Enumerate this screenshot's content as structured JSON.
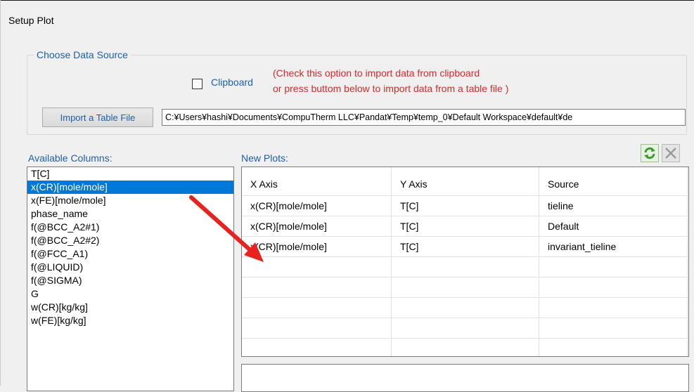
{
  "window": {
    "title": "Setup Plot"
  },
  "data_source": {
    "group_label": "Choose Data Source",
    "clipboard_label": "Clipboard",
    "clipboard_checked": false,
    "note_line1": "(Check this option to import data from clipboard",
    "note_line2": "or press buttom below to import data from a table file )",
    "import_button_label": "Import a Table File",
    "file_path": "C:¥Users¥hashi¥Documents¥CompuTherm LLC¥Pandat¥Temp¥temp_0¥Default Workspace¥default¥de"
  },
  "available_columns": {
    "label": "Available Columns:",
    "selected_index": 1,
    "items": [
      "T[C]",
      "x(CR)[mole/mole]",
      "x(FE)[mole/mole]",
      "phase_name",
      "f(@BCC_A2#1)",
      "f(@BCC_A2#2)",
      "f(@FCC_A1)",
      "f(@LIQUID)",
      "f(@SIGMA)",
      "G",
      "w(CR)[kg/kg]",
      "w(FE)[kg/kg]"
    ]
  },
  "new_plots": {
    "label": "New Plots:",
    "columns": [
      "X Axis",
      "Y Axis",
      "Source"
    ],
    "rows": [
      [
        "x(CR)[mole/mole]",
        "T[C]",
        "tieline"
      ],
      [
        "x(CR)[mole/mole]",
        "T[C]",
        "Default"
      ],
      [
        "x(CR)[mole/mole]",
        "T[C]",
        "invariant_tieline"
      ]
    ],
    "empty_rows": 5,
    "refresh_icon": "refresh-icon",
    "delete_icon": "delete-icon"
  },
  "colors": {
    "label_blue": "#1e5fa8",
    "note_red": "#d42a2a",
    "selection": "#0078d7",
    "annotation_arrow": "#e8231f"
  }
}
